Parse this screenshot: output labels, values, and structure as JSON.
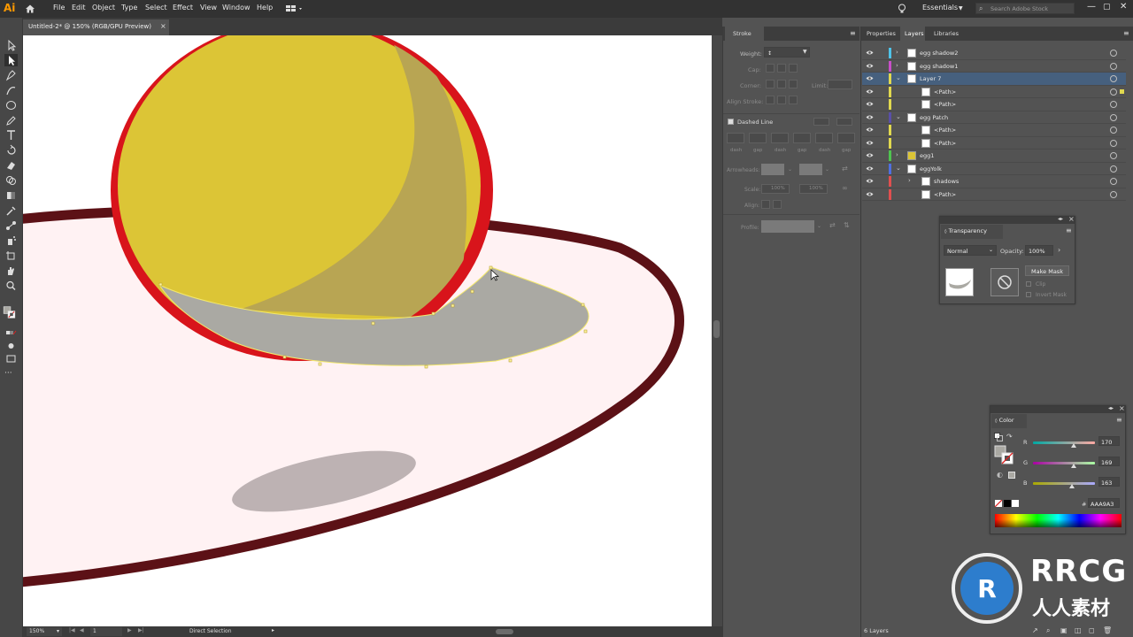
{
  "menubar": {
    "logo": "Ai",
    "items": [
      "File",
      "Edit",
      "Object",
      "Type",
      "Select",
      "Effect",
      "View",
      "Window",
      "Help"
    ],
    "workspace": "Essentials",
    "search_placeholder": "Search Adobe Stock"
  },
  "document": {
    "tab_title": "Untitled-2* @ 150% (RGB/GPU Preview)",
    "close": "×"
  },
  "statusbar": {
    "zoom": "150%",
    "artboard": "1",
    "tool": "Direct Selection"
  },
  "stroke_panel": {
    "title": "Stroke",
    "weight_label": "Weight:",
    "cap_label": "Cap:",
    "corner_label": "Corner:",
    "limit_label": "Limit:",
    "align_label": "Align Stroke:",
    "dashed_label": "Dashed Line",
    "dash_labels": [
      "dash",
      "gap",
      "dash",
      "gap",
      "dash",
      "gap"
    ],
    "arrowheads_label": "Arrowheads:",
    "scale_label": "Scale:",
    "scale_values": [
      "100%",
      "100%"
    ],
    "align_arrow_label": "Align:",
    "profile_label": "Profile:"
  },
  "right_panel": {
    "tabs": [
      "Properties",
      "Layers",
      "Libraries"
    ],
    "active_tab": "Layers",
    "layers": [
      {
        "name": "egg shadow2",
        "indent": 0,
        "color": "#4fc3e8",
        "chevron": ">",
        "selected": false
      },
      {
        "name": "egg shadow1",
        "indent": 0,
        "color": "#c84fc8",
        "chevron": ">",
        "selected": false
      },
      {
        "name": "Layer 7",
        "indent": 0,
        "color": "#e0d84f",
        "chevron": "v",
        "selected": true
      },
      {
        "name": "<Path>",
        "indent": 1,
        "color": "#e0d84f",
        "chevron": "",
        "selected": false
      },
      {
        "name": "<Path>",
        "indent": 1,
        "color": "#e0d84f",
        "chevron": "",
        "selected": false
      },
      {
        "name": "egg Patch",
        "indent": 0,
        "color": "#5a4fa8",
        "chevron": "v",
        "selected": false
      },
      {
        "name": "<Path>",
        "indent": 1,
        "color": "#e0d84f",
        "chevron": "",
        "selected": false
      },
      {
        "name": "<Path>",
        "indent": 1,
        "color": "#e0d84f",
        "chevron": "",
        "selected": false
      },
      {
        "name": "egg1",
        "indent": 0,
        "color": "#4fc34f",
        "chevron": ">",
        "selected": false
      },
      {
        "name": "eggYolk",
        "indent": 0,
        "color": "#4f6fe0",
        "chevron": "v",
        "selected": false
      },
      {
        "name": "shadows",
        "indent": 1,
        "color": "#e04f4f",
        "chevron": ">",
        "selected": false
      },
      {
        "name": "<Path>",
        "indent": 1,
        "color": "#e04f4f",
        "chevron": "",
        "selected": false
      }
    ],
    "layers_count": "6 Layers"
  },
  "transparency": {
    "title": "Transparency",
    "blend_mode": "Normal",
    "opacity_label": "Opacity:",
    "opacity_value": "100%",
    "make_mask": "Make Mask",
    "clip_label": "Clip",
    "invert_label": "Invert Mask"
  },
  "color_panel": {
    "title": "Color",
    "r_label": "R",
    "g_label": "G",
    "b_label": "B",
    "r_value": "170",
    "g_value": "169",
    "b_value": "163",
    "hash": "#",
    "hex": "AAA9A3"
  },
  "watermark": {
    "line1": "RRCG",
    "line2": "人人素材"
  },
  "colors": {
    "accent_selected": "#46607e",
    "yolk": "#dcc536",
    "yolk_outline": "#d8141b",
    "plate_outline": "#5c1116",
    "plate_fill": "#fff2f3",
    "shadow": "#aaa9a3"
  }
}
